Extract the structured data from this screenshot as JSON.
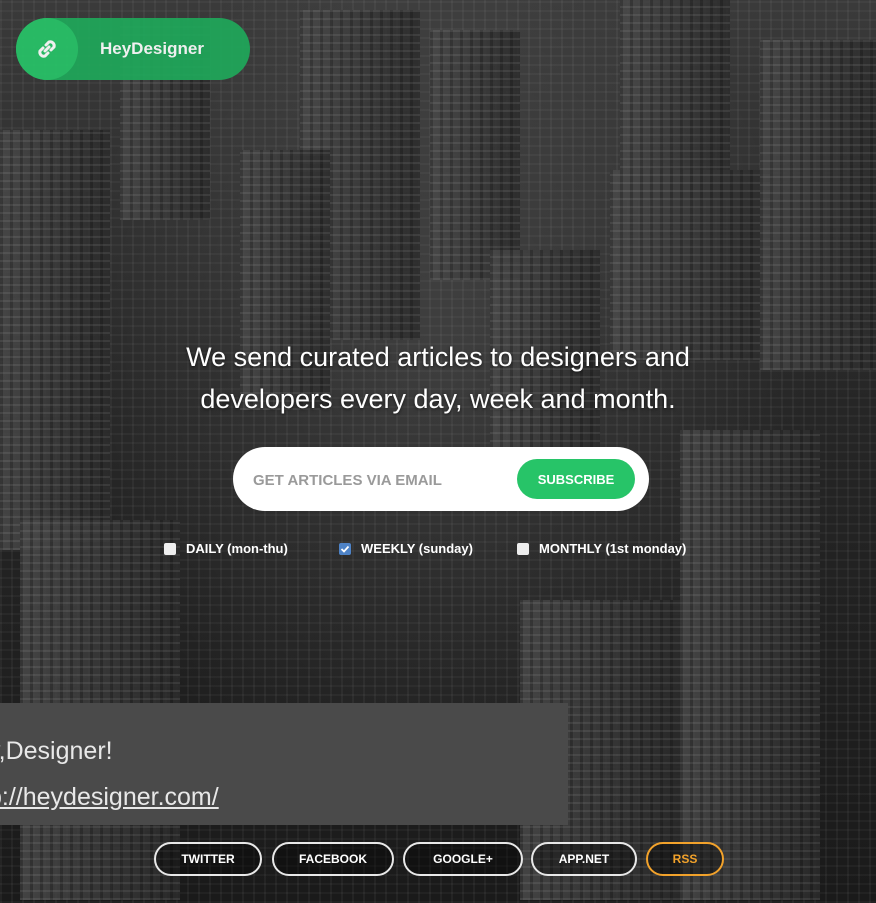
{
  "brand": {
    "name": "HeyDesigner",
    "logo_icon": "link-icon",
    "accent": "#27c468"
  },
  "hero": {
    "line1": "We send curated articles to designers and",
    "line2": "developers every day, week and month."
  },
  "signup": {
    "placeholder": "GET ARTICLES VIA EMAIL",
    "value": "",
    "button_label": "SUBSCRIBE"
  },
  "frequencies": [
    {
      "label": "DAILY (mon-thu)",
      "checked": false
    },
    {
      "label": "WEEKLY (sunday)",
      "checked": true
    },
    {
      "label": "MONTHLY (1st monday)",
      "checked": false
    }
  ],
  "social": {
    "twitter": "TWITTER",
    "facebook": "FACEBOOK",
    "googleplus": "GOOGLE+",
    "appnet": "APP.NET",
    "rss": "RSS",
    "rss_color": "#f2a22b"
  },
  "toast": {
    "line1": "y,Designer!",
    "line2": "p://heydesigner.com/"
  }
}
